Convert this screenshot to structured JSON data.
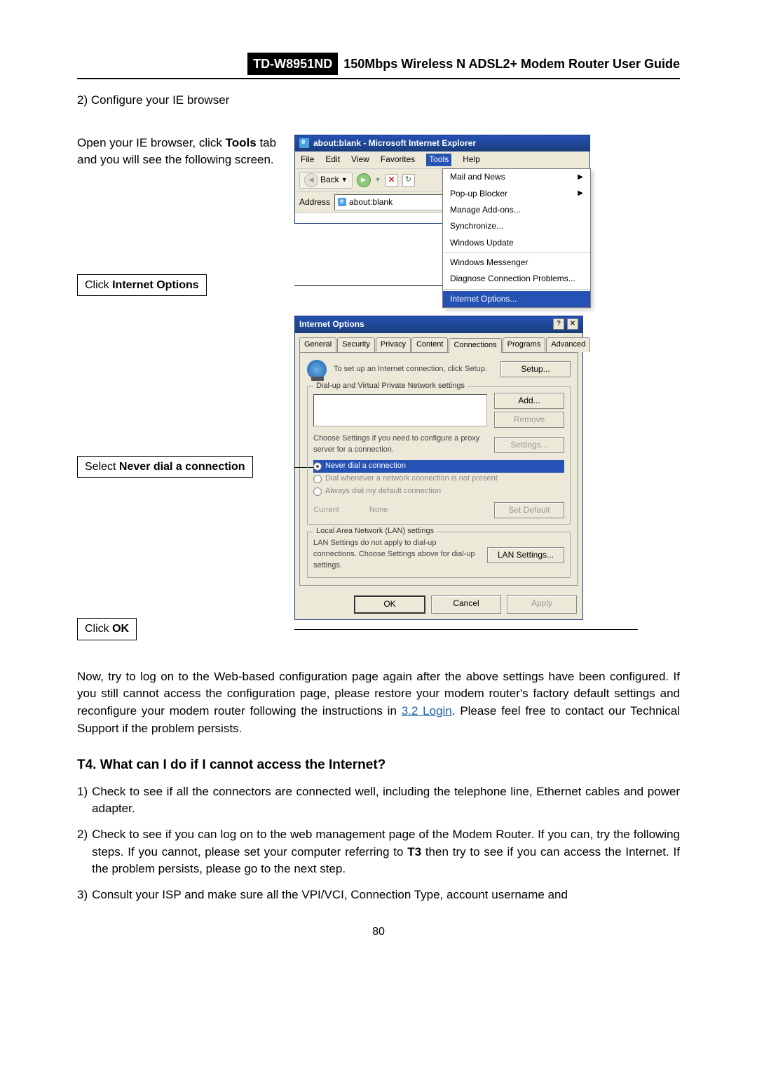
{
  "header": {
    "model": "TD-W8951ND",
    "title": "150Mbps Wireless N ADSL2+ Modem Router User Guide"
  },
  "step2": "2)  Configure your IE browser",
  "inst_open_1": "Open your IE browser, click ",
  "inst_open_b": "Tools",
  "inst_open_2": " tab and you will see the following screen.",
  "cap_io_1": "Click ",
  "cap_io_b": "Internet Options",
  "cap_nd_1": "Select ",
  "cap_nd_b": "Never dial a connection",
  "cap_ok_1": "Click ",
  "cap_ok_b": "OK",
  "ie": {
    "wintitle": "about:blank - Microsoft Internet Explorer",
    "menus": {
      "file": "File",
      "edit": "Edit",
      "view": "View",
      "fav": "Favorites",
      "tools": "Tools",
      "help": "Help"
    },
    "back": "Back",
    "addr_label": "Address",
    "addr_value": "about:blank",
    "menu": {
      "mail": "Mail and News",
      "popup": "Pop-up Blocker",
      "addons": "Manage Add-ons...",
      "sync": "Synchronize...",
      "wu": "Windows Update",
      "wm": "Windows Messenger",
      "diag": "Diagnose Connection Problems...",
      "io": "Internet Options..."
    }
  },
  "dlg": {
    "title": "Internet Options",
    "tabs": {
      "gen": "General",
      "sec": "Security",
      "priv": "Privacy",
      "cont": "Content",
      "conn": "Connections",
      "prog": "Programs",
      "adv": "Advanced"
    },
    "setup_text": "To set up an Internet connection, click Setup.",
    "setup_btn": "Setup...",
    "grp_dial": "Dial-up and Virtual Private Network settings",
    "add": "Add...",
    "remove": "Remove",
    "proxy_text": "Choose Settings if you need to configure a proxy server for a connection.",
    "settings": "Settings...",
    "r1": "Never dial a connection",
    "r2": "Dial whenever a network connection is not present",
    "r3": "Always dial my default connection",
    "cur": "Current",
    "none": "None",
    "setdef": "Set Default",
    "grp_lan": "Local Area Network (LAN) settings",
    "lan_text": "LAN Settings do not apply to dial-up connections. Choose Settings above for dial-up settings.",
    "lan_btn": "LAN Settings...",
    "ok": "OK",
    "cancel": "Cancel",
    "apply": "Apply"
  },
  "para": {
    "p1a": "Now, try to log on to the Web-based configuration page again after the above settings have been configured. If you still cannot access the configuration page, please restore your modem router's factory default settings and reconfigure your modem router following the instructions in ",
    "link": "3.2 Login",
    "p1b": ". Please feel free to contact our Technical Support if the problem persists."
  },
  "t4": "T4. What can I do if I cannot access the Internet?",
  "t4_1": "Check to see if all the connectors are connected well, including the telephone line, Ethernet cables and power adapter.",
  "t4_2a": "Check to see if you can log on to the web management page of the Modem Router. If you can, try the following steps. If you cannot, please set your computer referring to ",
  "t4_2b": "T3",
  "t4_2c": " then try to see if you can access the Internet. If the problem persists, please go to the next step.",
  "t4_3": "Consult your ISP and make sure all the VPI/VCI, Connection Type, account username and",
  "pagenum": "80"
}
